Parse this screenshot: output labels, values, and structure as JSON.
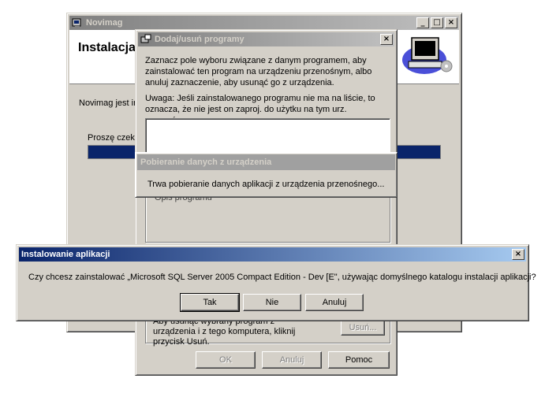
{
  "novimag_window": {
    "title": "Novimag",
    "header": "Instalacja",
    "body_text": "Novimag jest in",
    "progress_label": "Proszę czek",
    "controls": {
      "minimize": "_",
      "maximize": "□",
      "close": "×"
    }
  },
  "add_remove_dialog": {
    "title": "Dodaj/usuń programy",
    "intro": "Zaznacz pole wyboru związane z danym programem, aby zainstalować ten program na urządzeniu przenośnym, albo anuluj zaznaczenie, aby usunąć go z urządzenia.",
    "note": "Uwaga: Jeśli zainstalowanego programu nie ma na liście, to oznacza, że nie jest on zaproj. do użytku na tym urz. przenośnym.",
    "description_label": "Opis programu",
    "remove_text": "Aby usunąć wybrany program z urządzenia i z tego komputera, kliknij przycisk Usuń.",
    "remove_button": "Usuń...",
    "buttons": {
      "ok": "OK",
      "cancel": "Anuluj",
      "help": "Pomoc"
    },
    "close": "×"
  },
  "fetch_dialog": {
    "title": "Pobieranie danych z urządzenia",
    "message": "Trwa pobieranie danych aplikacji z urządzenia przenośnego..."
  },
  "install_dialog": {
    "title": "Instalowanie aplikacji",
    "message": "Czy chcesz zainstalować „Microsoft SQL Server 2005 Compact Edition - Dev [E\", używając domyślnego katalogu instalacji aplikacji?",
    "buttons": {
      "yes": "Tak",
      "no": "Nie",
      "cancel": "Anuluj"
    },
    "close": "×"
  },
  "colors": {
    "active_title": "#0a246a",
    "inactive_title": "#808080",
    "progress": "#0a246a",
    "face": "#d4d0c8"
  }
}
